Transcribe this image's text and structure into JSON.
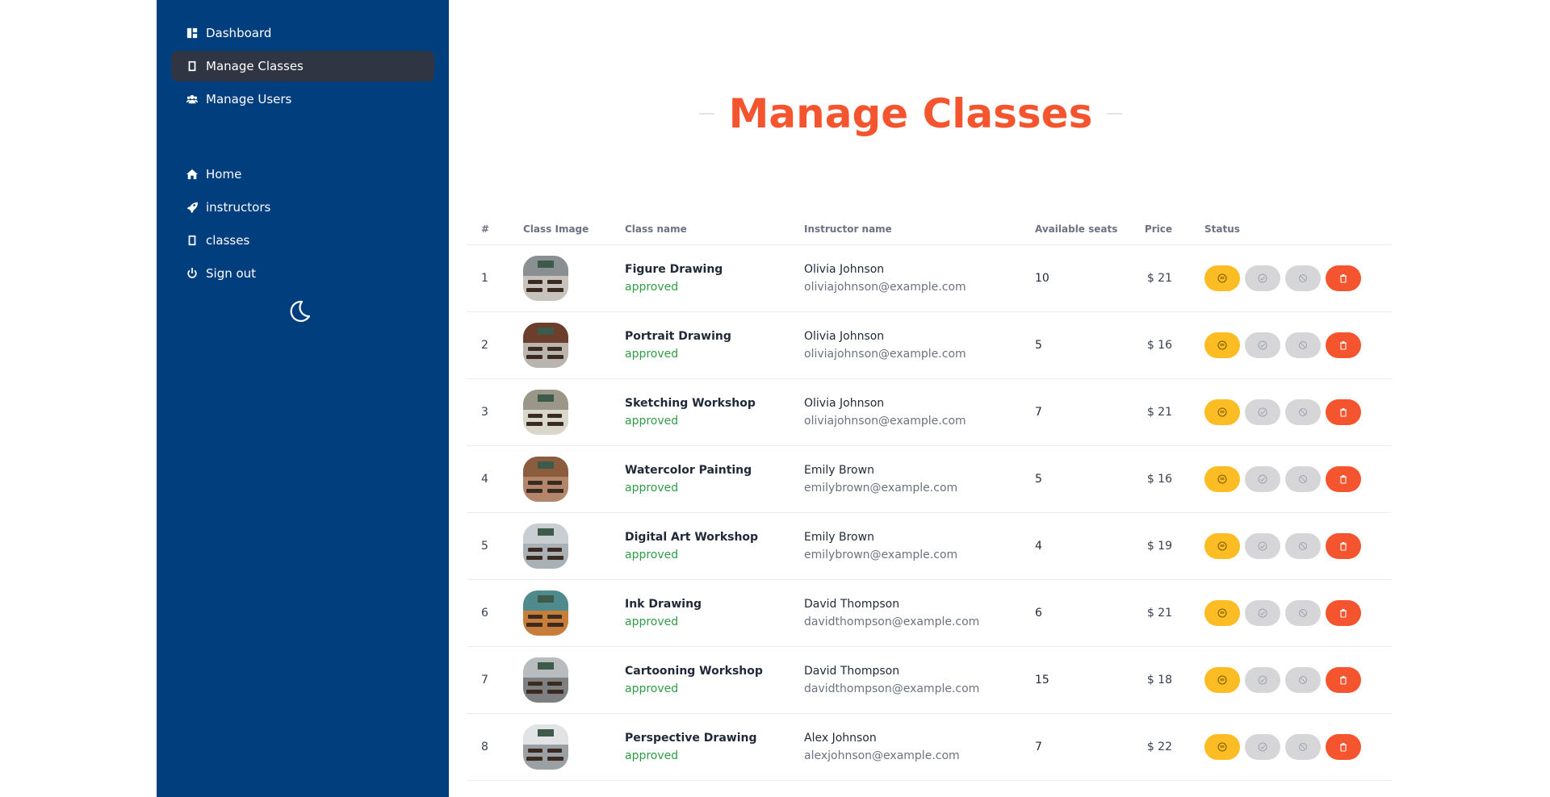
{
  "sidebar": {
    "top_items": [
      {
        "label": "Dashboard",
        "icon": "dashboard-icon",
        "active": false
      },
      {
        "label": "Manage Classes",
        "icon": "book-icon",
        "active": true
      },
      {
        "label": "Manage Users",
        "icon": "users-icon",
        "active": false
      }
    ],
    "bottom_items": [
      {
        "label": "Home",
        "icon": "home-icon"
      },
      {
        "label": "instructors",
        "icon": "rocket-icon"
      },
      {
        "label": "classes",
        "icon": "book-icon"
      },
      {
        "label": "Sign out",
        "icon": "power-icon"
      }
    ],
    "theme_toggle_icon": "moon-icon"
  },
  "main": {
    "title": "Manage Classes",
    "table": {
      "headers": [
        "#",
        "Class Image",
        "Class name",
        "Instructor name",
        "Available seats",
        "Price",
        "Status"
      ],
      "rows": [
        {
          "num": "1",
          "class_name": "Figure Drawing",
          "status": "approved",
          "instructor": "Olivia Johnson",
          "email": "oliviajohnson@example.com",
          "seats": "10",
          "price": "$ 21"
        },
        {
          "num": "2",
          "class_name": "Portrait Drawing",
          "status": "approved",
          "instructor": "Olivia Johnson",
          "email": "oliviajohnson@example.com",
          "seats": "5",
          "price": "$ 16"
        },
        {
          "num": "3",
          "class_name": "Sketching Workshop",
          "status": "approved",
          "instructor": "Olivia Johnson",
          "email": "oliviajohnson@example.com",
          "seats": "7",
          "price": "$ 21"
        },
        {
          "num": "4",
          "class_name": "Watercolor Painting",
          "status": "approved",
          "instructor": "Emily Brown",
          "email": "emilybrown@example.com",
          "seats": "5",
          "price": "$ 16"
        },
        {
          "num": "5",
          "class_name": "Digital Art Workshop",
          "status": "approved",
          "instructor": "Emily Brown",
          "email": "emilybrown@example.com",
          "seats": "4",
          "price": "$ 19"
        },
        {
          "num": "6",
          "class_name": "Ink Drawing",
          "status": "approved",
          "instructor": "David Thompson",
          "email": "davidthompson@example.com",
          "seats": "6",
          "price": "$ 21"
        },
        {
          "num": "7",
          "class_name": "Cartooning Workshop",
          "status": "approved",
          "instructor": "David Thompson",
          "email": "davidthompson@example.com",
          "seats": "15",
          "price": "$ 18"
        },
        {
          "num": "8",
          "class_name": "Perspective Drawing",
          "status": "approved",
          "instructor": "Alex Johnson",
          "email": "alexjohnson@example.com",
          "seats": "7",
          "price": "$ 22"
        }
      ]
    },
    "action_buttons": [
      {
        "name": "pending-button",
        "icon": "minus-circle-icon",
        "color": "#fbbd23"
      },
      {
        "name": "approve-button",
        "icon": "check-circle-icon",
        "color": "#d6d6d9"
      },
      {
        "name": "deny-button",
        "icon": "ban-icon",
        "color": "#d6d6d9"
      },
      {
        "name": "delete-button",
        "icon": "trash-icon",
        "color": "#f4552e"
      }
    ]
  },
  "colors": {
    "sidebar_bg": "#013e7e",
    "sidebar_active": "#2f3542",
    "title": "#f4552e",
    "approved": "#2f9b46"
  }
}
